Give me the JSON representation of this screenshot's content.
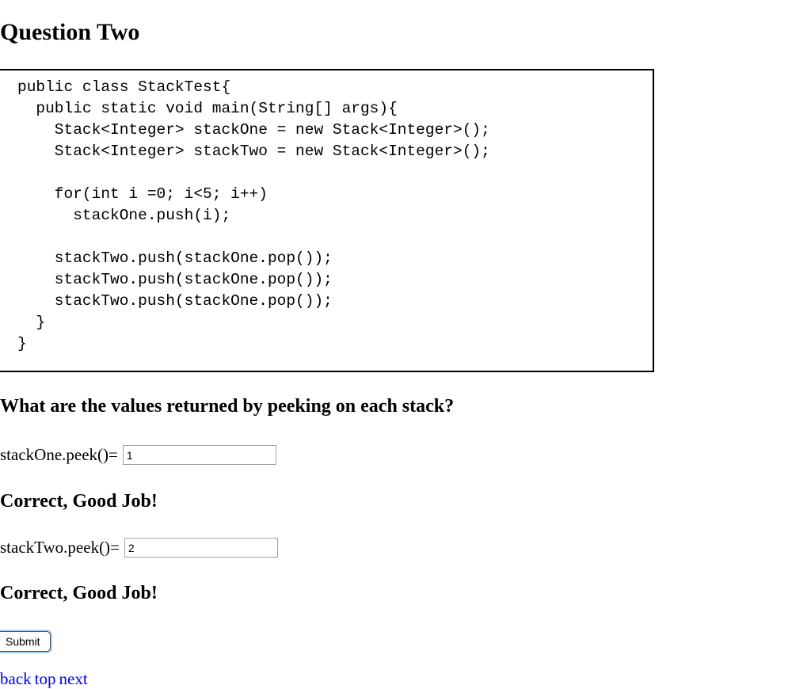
{
  "heading": "Question Two",
  "code": {
    "lines": [
      "public class StackTest{",
      "  public static void main(String[] args){",
      "    Stack<Integer> stackOne = new Stack<Integer>();",
      "    Stack<Integer> stackTwo = new Stack<Integer>();",
      "",
      "    for(int i =0; i<5; i++)",
      "      stackOne.push(i);",
      "",
      "    stackTwo.push(stackOne.pop());",
      "    stackTwo.push(stackOne.pop());",
      "    stackTwo.push(stackOne.pop());",
      "  }",
      "}"
    ],
    "text": "public class StackTest{\n  public static void main(String[] args){\n    Stack<Integer> stackOne = new Stack<Integer>();\n    Stack<Integer> stackTwo = new Stack<Integer>();\n\n    for(int i =0; i<5; i++)\n      stackOne.push(i);\n\n    stackTwo.push(stackOne.pop());\n    stackTwo.push(stackOne.pop());\n    stackTwo.push(stackOne.pop());\n  }\n}"
  },
  "prompt": "What are the values returned by peeking on each stack?",
  "answers": [
    {
      "label": "stackOne.peek()=",
      "value": "1",
      "placeholder": "",
      "feedback": "Correct, Good Job!"
    },
    {
      "label": "stackTwo.peek()=",
      "value": "2",
      "placeholder": "",
      "feedback": "Correct, Good Job!"
    }
  ],
  "submit_label": "Submit",
  "nav": {
    "back": "back",
    "top": "top",
    "next": "next"
  },
  "colors": {
    "link": "#0000ee",
    "code_border": "#000000",
    "input_border": "#a0a0a0",
    "focus_ring": "#aed0f0"
  }
}
